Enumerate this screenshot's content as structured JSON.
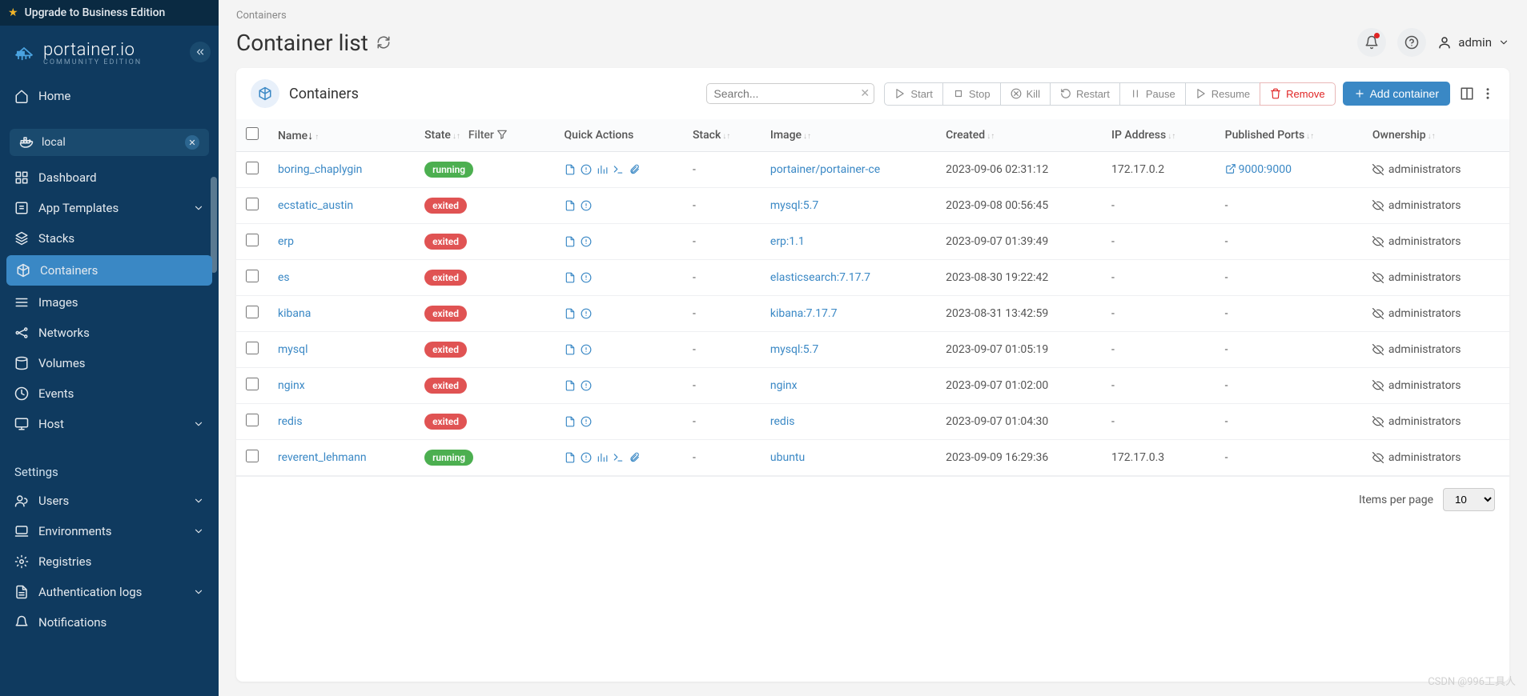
{
  "upgrade_label": "Upgrade to Business Edition",
  "brand": {
    "name": "portainer.io",
    "edition": "COMMUNITY EDITION"
  },
  "nav": {
    "home": "Home",
    "env_name": "local",
    "items": [
      "Dashboard",
      "App Templates",
      "Stacks",
      "Containers",
      "Images",
      "Networks",
      "Volumes",
      "Events",
      "Host"
    ],
    "settings_label": "Settings",
    "settings_items": [
      "Users",
      "Environments",
      "Registries",
      "Authentication logs",
      "Notifications"
    ]
  },
  "header": {
    "user": "admin"
  },
  "breadcrumb": "Containers",
  "page_title": "Container list",
  "panel": {
    "title": "Containers",
    "search_placeholder": "Search...",
    "actions": {
      "start": "Start",
      "stop": "Stop",
      "kill": "Kill",
      "restart": "Restart",
      "pause": "Pause",
      "resume": "Resume",
      "remove": "Remove"
    },
    "add_label": "Add container",
    "items_per_page_label": "Items per page",
    "items_per_page_value": "10"
  },
  "table": {
    "cols": {
      "name": "Name",
      "state": "State",
      "filter": "Filter",
      "qa": "Quick Actions",
      "stack": "Stack",
      "image": "Image",
      "created": "Created",
      "ip": "IP Address",
      "ports": "Published Ports",
      "owner": "Ownership"
    },
    "rows": [
      {
        "name": "boring_chaplygin",
        "state": "running",
        "full": true,
        "stack": "-",
        "image": "portainer/portainer-ce",
        "created": "2023-09-06 02:31:12",
        "ip": "172.17.0.2",
        "ports": "9000:9000",
        "owner": "administrators"
      },
      {
        "name": "ecstatic_austin",
        "state": "exited",
        "full": false,
        "stack": "-",
        "image": "mysql:5.7",
        "created": "2023-09-08 00:56:45",
        "ip": "-",
        "ports": "-",
        "owner": "administrators"
      },
      {
        "name": "erp",
        "state": "exited",
        "full": false,
        "stack": "-",
        "image": "erp:1.1",
        "created": "2023-09-07 01:39:49",
        "ip": "-",
        "ports": "-",
        "owner": "administrators"
      },
      {
        "name": "es",
        "state": "exited",
        "full": false,
        "stack": "-",
        "image": "elasticsearch:7.17.7",
        "created": "2023-08-30 19:22:42",
        "ip": "-",
        "ports": "-",
        "owner": "administrators"
      },
      {
        "name": "kibana",
        "state": "exited",
        "full": false,
        "stack": "-",
        "image": "kibana:7.17.7",
        "created": "2023-08-31 13:42:59",
        "ip": "-",
        "ports": "-",
        "owner": "administrators"
      },
      {
        "name": "mysql",
        "state": "exited",
        "full": false,
        "stack": "-",
        "image": "mysql:5.7",
        "created": "2023-09-07 01:05:19",
        "ip": "-",
        "ports": "-",
        "owner": "administrators"
      },
      {
        "name": "nginx",
        "state": "exited",
        "full": false,
        "stack": "-",
        "image": "nginx",
        "created": "2023-09-07 01:02:00",
        "ip": "-",
        "ports": "-",
        "owner": "administrators"
      },
      {
        "name": "redis",
        "state": "exited",
        "full": false,
        "stack": "-",
        "image": "redis",
        "created": "2023-09-07 01:04:30",
        "ip": "-",
        "ports": "-",
        "owner": "administrators"
      },
      {
        "name": "reverent_lehmann",
        "state": "running",
        "full": true,
        "stack": "-",
        "image": "ubuntu",
        "created": "2023-09-09 16:29:36",
        "ip": "172.17.0.3",
        "ports": "-",
        "owner": "administrators"
      }
    ]
  },
  "watermark": "CSDN @996工具人"
}
